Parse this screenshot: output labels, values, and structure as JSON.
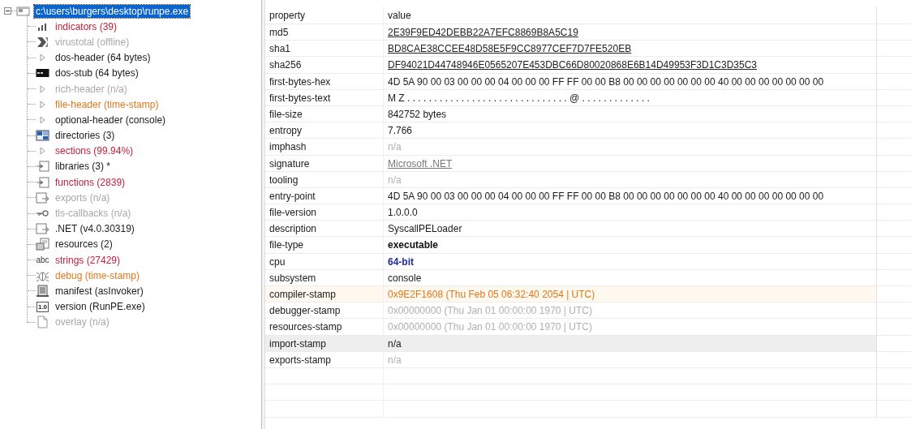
{
  "tree": {
    "label": "c:\\users\\burgers\\desktop\\runpe.exe",
    "selected": true,
    "expanded": true,
    "children": [
      {
        "label": "indicators (39)",
        "color": "#c4203a",
        "kind": "chart"
      },
      {
        "label": "virustotal (offline)",
        "color": "#a8a8a8",
        "kind": "chevron"
      },
      {
        "label": "dos-header (64 bytes)",
        "color": "#1a1a1a",
        "kind": "expander"
      },
      {
        "label": "dos-stub (64 bytes)",
        "color": "#1a1a1a",
        "kind": "console"
      },
      {
        "label": "rich-header (n/a)",
        "color": "#a8a8a8",
        "kind": "expander"
      },
      {
        "label": "file-header (time-stamp)",
        "color": "#e0781c",
        "kind": "expander"
      },
      {
        "label": "optional-header (console)",
        "color": "#1a1a1a",
        "kind": "expander"
      },
      {
        "label": "directories (3)",
        "color": "#1a1a1a",
        "kind": "grid"
      },
      {
        "label": "sections (99.94%)",
        "color": "#c4203a",
        "kind": "expander"
      },
      {
        "label": "libraries (3) *",
        "color": "#1a1a1a",
        "kind": "module"
      },
      {
        "label": "functions (2839)",
        "color": "#c4203a",
        "kind": "module"
      },
      {
        "label": "exports (n/a)",
        "color": "#a8a8a8",
        "kind": "export"
      },
      {
        "label": "tls-callbacks (n/a)",
        "color": "#a8a8a8",
        "kind": "key"
      },
      {
        "label": ".NET (v4.0.30319)",
        "color": "#1a1a1a",
        "kind": "export"
      },
      {
        "label": "resources (2)",
        "color": "#1a1a1a",
        "kind": "resources"
      },
      {
        "label": "strings (27429)",
        "color": "#c4203a",
        "kind": "glyph",
        "glyph": "abc"
      },
      {
        "label": "debug (time-stamp)",
        "color": "#e0781c",
        "kind": "bug"
      },
      {
        "label": "manifest (asInvoker)",
        "color": "#1a1a1a",
        "kind": "manifest"
      },
      {
        "label": "version (RunPE.exe)",
        "color": "#1a1a1a",
        "kind": "tag",
        "glyph": "1.0"
      },
      {
        "label": "overlay (n/a)",
        "color": "#a8a8a8",
        "kind": "page"
      }
    ]
  },
  "table": {
    "columns": [
      "property",
      "value"
    ],
    "rows": [
      {
        "property": "md5",
        "value": "2E39F9ED42DEBB22A7EFC8869B8A5C19",
        "kind": "link",
        "selected": false
      },
      {
        "property": "sha1",
        "value": "BD8CAE38CCEE48D58E5F9CC8977CEF7D7FE520EB",
        "kind": "link",
        "selected": false
      },
      {
        "property": "sha256",
        "value": "DF94021D44748946E0565207E453DBC66D80020868E6B14D49953F3D1C3D35C3",
        "kind": "link",
        "selected": false
      },
      {
        "property": "first-bytes-hex",
        "value": "4D 5A 90 00 03 00 00 00 04 00 00 00 FF FF 00 00 B8 00 00 00 00 00 00 00 40 00 00 00 00 00 00 00",
        "kind": "plain",
        "selected": false
      },
      {
        "property": "first-bytes-text",
        "value": "M Z . . . . . . . . . . . . . . . . . . . . . . . . . . . . . . @ . . . . . . . . . . . . .",
        "kind": "plain",
        "selected": false
      },
      {
        "property": "file-size",
        "value": "842752 bytes",
        "kind": "plain",
        "selected": false
      },
      {
        "property": "entropy",
        "value": "7.766",
        "kind": "plain",
        "selected": false
      },
      {
        "property": "imphash",
        "value": "n/a",
        "kind": "muted",
        "selected": false
      },
      {
        "property": "signature",
        "value": "Microsoft .NET",
        "kind": "weaklink",
        "selected": false
      },
      {
        "property": "tooling",
        "value": "n/a",
        "kind": "muted",
        "selected": false
      },
      {
        "property": "entry-point",
        "value": "4D 5A 90 00 03 00 00 00 04 00 00 00 FF FF 00 00 B8 00 00 00 00 00 00 00 40 00 00 00 00 00 00 00",
        "kind": "plain",
        "selected": false
      },
      {
        "property": "file-version",
        "value": "1.0.0.0",
        "kind": "plain",
        "selected": false
      },
      {
        "property": "description",
        "value": "SyscallPELoader",
        "kind": "plain",
        "selected": false
      },
      {
        "property": "file-type",
        "value": "executable",
        "kind": "bold",
        "selected": false
      },
      {
        "property": "cpu",
        "value": "64-bit",
        "kind": "accent",
        "selected": false
      },
      {
        "property": "subsystem",
        "value": "console",
        "kind": "plain",
        "selected": false
      },
      {
        "property": "compiler-stamp",
        "value": "0x9E2F1608 (Thu Feb 05 06:32:40 2054 | UTC)",
        "kind": "warn",
        "selected": false
      },
      {
        "property": "debugger-stamp",
        "value": "0x00000000 (Thu Jan 01 00:00:00 1970 | UTC)",
        "kind": "muted",
        "selected": false
      },
      {
        "property": "resources-stamp",
        "value": "0x00000000 (Thu Jan 01 00:00:00 1970 | UTC)",
        "kind": "muted",
        "selected": false
      },
      {
        "property": "import-stamp",
        "value": "n/a",
        "kind": "plain",
        "selected": true
      },
      {
        "property": "exports-stamp",
        "value": "n/a",
        "kind": "muted",
        "selected": false
      }
    ]
  }
}
